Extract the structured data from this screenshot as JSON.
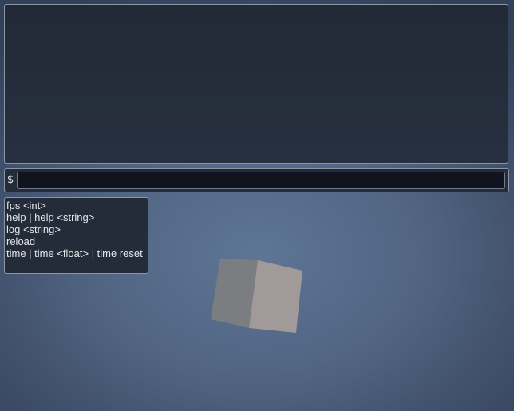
{
  "console": {
    "prompt": "$",
    "input_value": "",
    "suggestions": [
      "fps <int>",
      "help | help <string>",
      "log <string>",
      "reload",
      "time | time <float> | time reset"
    ]
  },
  "scene": {
    "background_color": "#526684",
    "cube_left_color": "#7b7d80",
    "cube_right_color": "#a29a98"
  }
}
